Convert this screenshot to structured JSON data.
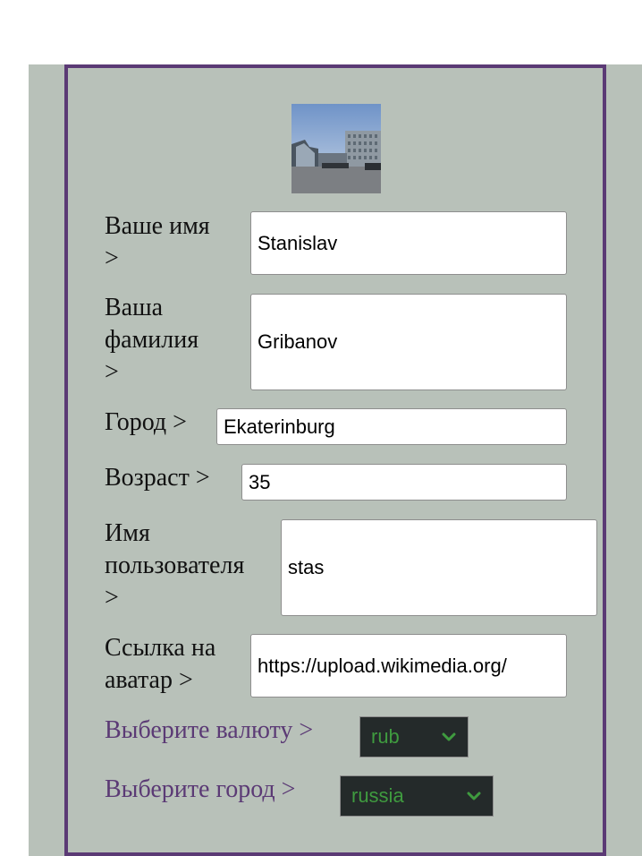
{
  "form": {
    "first_name": {
      "label": "Ваше имя\n>",
      "value": "Stanislav"
    },
    "last_name": {
      "label": "Ваша\nфамилия\n>",
      "value": "Gribanov"
    },
    "city": {
      "label": "Город >",
      "value": "Ekaterinburg"
    },
    "age": {
      "label": "Возраст >",
      "value": "35"
    },
    "username": {
      "label": "Имя\nпользователя\n>",
      "value": "stas"
    },
    "avatar_url": {
      "label": "Ссылка на\nаватар >",
      "value": "https://upload.wikimedia.org/"
    },
    "currency": {
      "label": "Выберите валюту >",
      "selected": "rub",
      "icon": "chevron-down-icon"
    },
    "region": {
      "label": "Выберите город >",
      "selected": "russia",
      "icon": "chevron-down-icon"
    }
  },
  "colors": {
    "background_panel": "#b8c1b9",
    "border": "#5b3a75",
    "select_bg": "#242a2a",
    "select_text": "#3f9b3f"
  }
}
